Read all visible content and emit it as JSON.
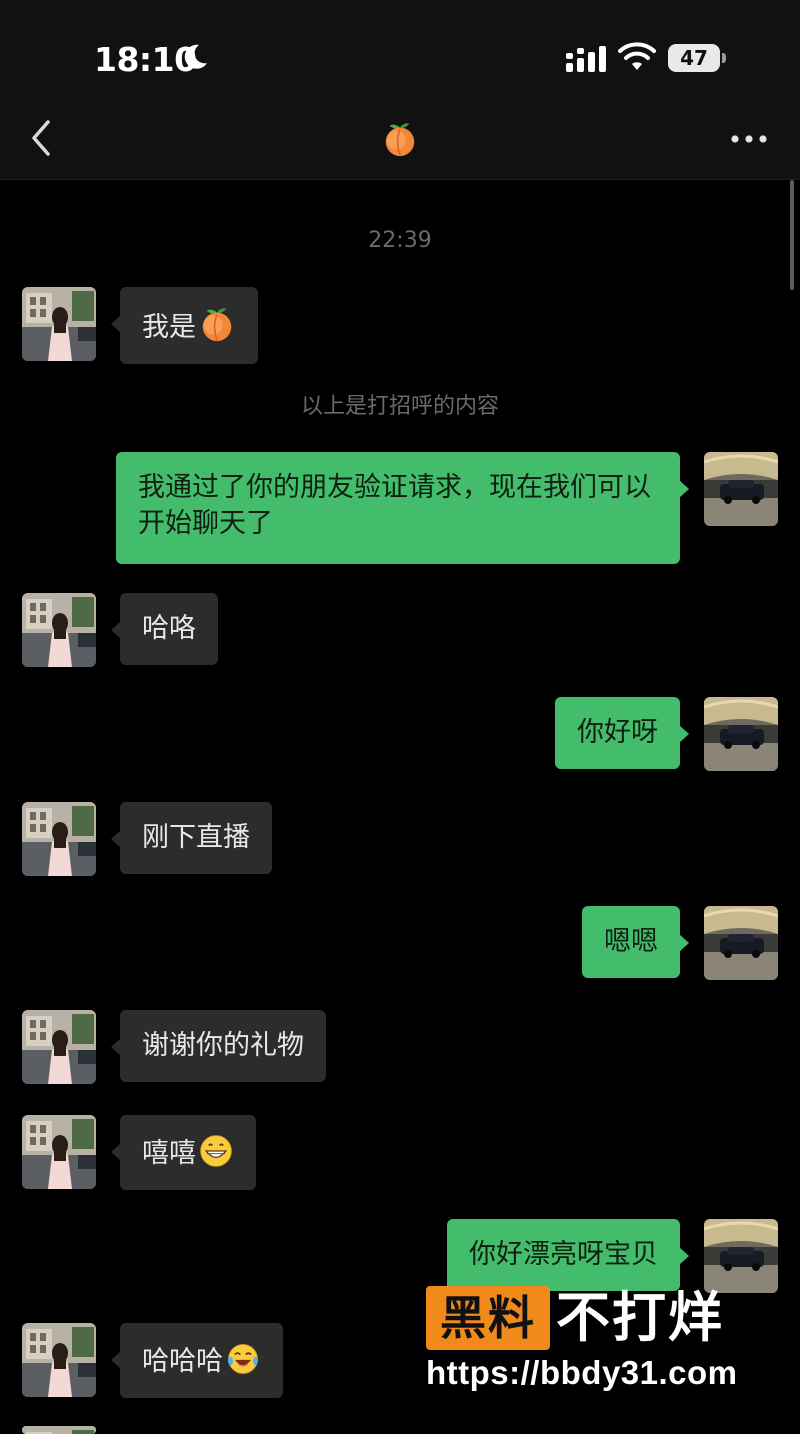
{
  "status_bar": {
    "time": "18:10",
    "battery": "47",
    "icons": [
      "moon-icon",
      "signal-icon",
      "wifi-icon",
      "battery-icon"
    ]
  },
  "nav": {
    "title_icon": "peach-emoji-icon",
    "back_icon": "back-chevron-icon",
    "more_icon": "more-dots-icon"
  },
  "chat": {
    "timestamp": "22:39",
    "system_note": "以上是打招呼的内容",
    "messages": [
      {
        "side": "in",
        "text": "我是",
        "emoji": "peach-emoji-icon"
      },
      {
        "side": "out",
        "text": "我通过了你的朋友验证请求，现在我们可以开始聊天了"
      },
      {
        "side": "in",
        "text": "哈咯"
      },
      {
        "side": "out",
        "text": "你好呀"
      },
      {
        "side": "in",
        "text": "刚下直播"
      },
      {
        "side": "out",
        "text": "嗯嗯"
      },
      {
        "side": "in",
        "text": "谢谢你的礼物"
      },
      {
        "side": "in",
        "text": "嘻嘻",
        "emoji": "grin-emoji-icon"
      },
      {
        "side": "out",
        "text": "你好漂亮呀宝贝"
      },
      {
        "side": "in",
        "text": "哈哈哈",
        "emoji": "tears-of-joy-emoji-icon"
      }
    ]
  },
  "watermark": {
    "badge": "黑料",
    "text": "不打烊",
    "url": "https://bbdy31.com"
  },
  "colors": {
    "background": "#000000",
    "bubble_in": "#2c2c2c",
    "bubble_out": "#43bd6b",
    "watermark_orange": "#f08a1a"
  }
}
